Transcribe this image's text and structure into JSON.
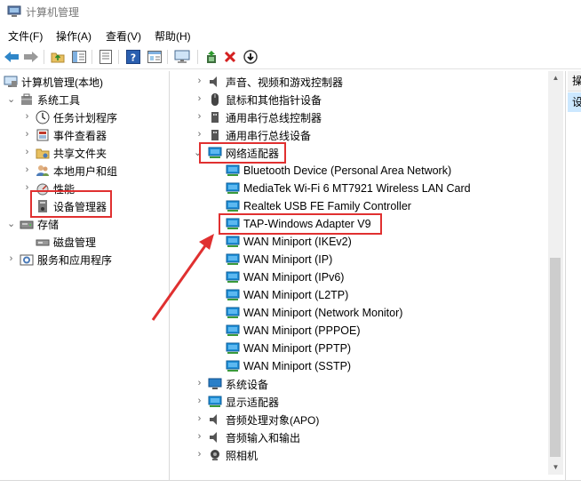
{
  "window": {
    "title": "计算机管理"
  },
  "menu": [
    "文件(F)",
    "操作(A)",
    "查看(V)",
    "帮助(H)"
  ],
  "toolbar": {
    "icons": [
      "back-arrow-icon",
      "forward-arrow-icon",
      "up-folder-icon",
      "show-hide-tree-icon",
      "properties-icon",
      "help-icon",
      "view-icon",
      "monitor-icon",
      "update-driver-icon",
      "uninstall-icon",
      "download-icon"
    ]
  },
  "left_tree": {
    "root": "计算机管理(本地)",
    "system_tools": "系统工具",
    "task_scheduler": "任务计划程序",
    "event_viewer": "事件查看器",
    "shared_folders": "共享文件夹",
    "local_users": "本地用户和组",
    "performance": "性能",
    "device_manager": "设备管理器",
    "storage": "存储",
    "disk_management": "磁盘管理",
    "services_apps": "服务和应用程序"
  },
  "devices": {
    "categories_top": [
      {
        "label": "声音、视频和游戏控制器",
        "icon": "speaker-icon"
      },
      {
        "label": "鼠标和其他指针设备",
        "icon": "mouse-icon"
      },
      {
        "label": "通用串行总线控制器",
        "icon": "usb-icon"
      },
      {
        "label": "通用串行总线设备",
        "icon": "usb-icon"
      }
    ],
    "network_adapters": "网络适配器",
    "adapters": [
      "Bluetooth Device (Personal Area Network)",
      "MediaTek Wi-Fi 6 MT7921 Wireless LAN Card",
      "Realtek USB FE Family Controller",
      "TAP-Windows Adapter V9",
      "WAN Miniport (IKEv2)",
      "WAN Miniport (IP)",
      "WAN Miniport (IPv6)",
      "WAN Miniport (L2TP)",
      "WAN Miniport (Network Monitor)",
      "WAN Miniport (PPPOE)",
      "WAN Miniport (PPTP)",
      "WAN Miniport (SSTP)"
    ],
    "categories_bottom": [
      {
        "label": "系统设备",
        "icon": "computer-icon"
      },
      {
        "label": "显示适配器",
        "icon": "display-icon"
      },
      {
        "label": "音频处理对象(APO)",
        "icon": "speaker-icon"
      },
      {
        "label": "音频输入和输出",
        "icon": "speaker-icon"
      },
      {
        "label": "照相机",
        "icon": "camera-icon"
      }
    ]
  },
  "right_pane": {
    "header": "操",
    "selected": "设"
  },
  "colors": {
    "highlight": "#e03030",
    "selection": "#cce8ff",
    "adapter_icon": "#1e8fd8"
  }
}
